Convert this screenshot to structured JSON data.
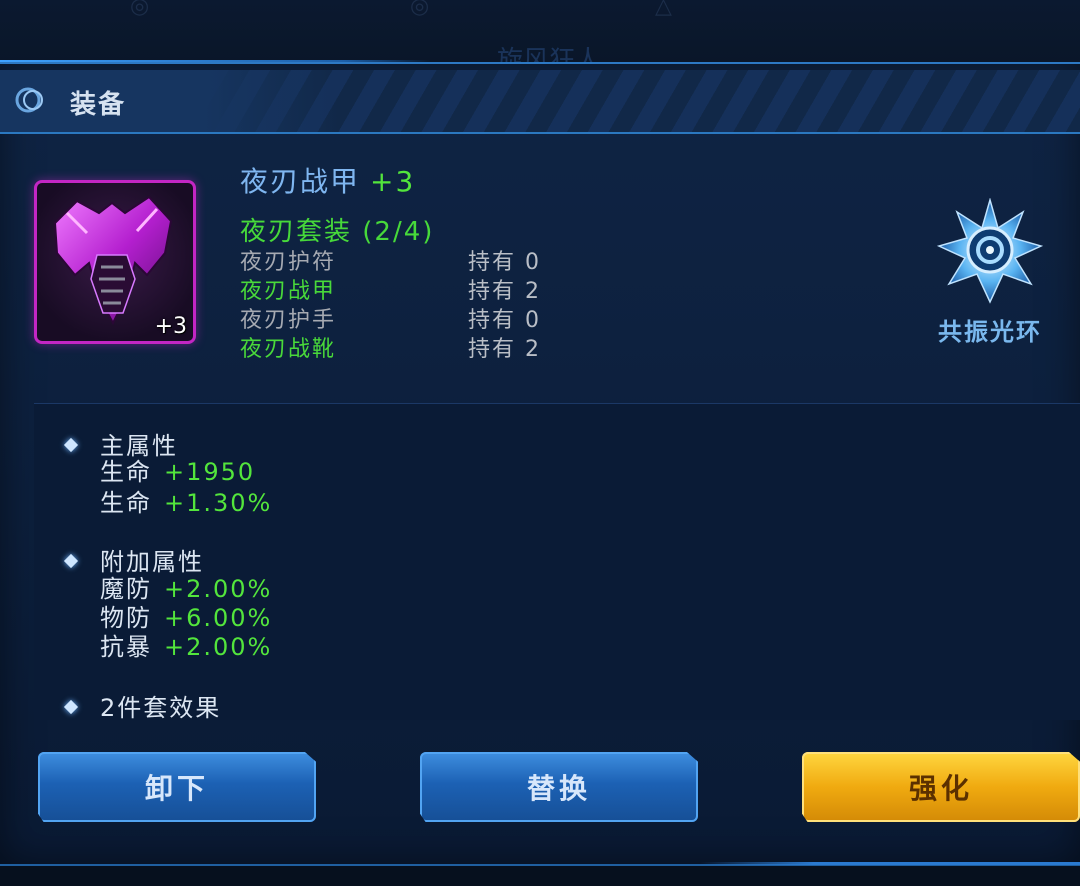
{
  "window": {
    "title": "装备",
    "bg_title": "旋风狂人"
  },
  "item": {
    "name": "夜刃战甲",
    "level_label": "+3",
    "badge": "+3",
    "icon": "purple-armor-icon",
    "frame_color": "#c326c4"
  },
  "set": {
    "title": "夜刃套装 (2/4)",
    "pieces": [
      {
        "name": "夜刃护符",
        "owned": "持有 0",
        "active": false
      },
      {
        "name": "夜刃战甲",
        "owned": "持有 2",
        "active": true
      },
      {
        "name": "夜刃护手",
        "owned": "持有 0",
        "active": false
      },
      {
        "name": "夜刃战靴",
        "owned": "持有 2",
        "active": true
      }
    ]
  },
  "aura": {
    "label": "共振光环",
    "icon": "aura-emblem-icon"
  },
  "main_attr": {
    "title": "主属性",
    "rows": [
      {
        "key": "生命",
        "value": "+1950"
      },
      {
        "key": "生命",
        "value": "+1.30%"
      }
    ]
  },
  "extra_attr": {
    "title": "附加属性",
    "rows": [
      {
        "key": "魔防",
        "value": "+2.00%"
      },
      {
        "key": "物防",
        "value": "+6.00%"
      },
      {
        "key": "抗暴",
        "value": "+2.00%"
      }
    ]
  },
  "set_effect": {
    "title": "2件套效果"
  },
  "buttons": {
    "unequip": "卸下",
    "replace": "替换",
    "enhance": "强化"
  },
  "colors": {
    "accent_blue": "#2b78c0",
    "active_green": "#53e53c",
    "gold_button": "#f0aa10"
  }
}
